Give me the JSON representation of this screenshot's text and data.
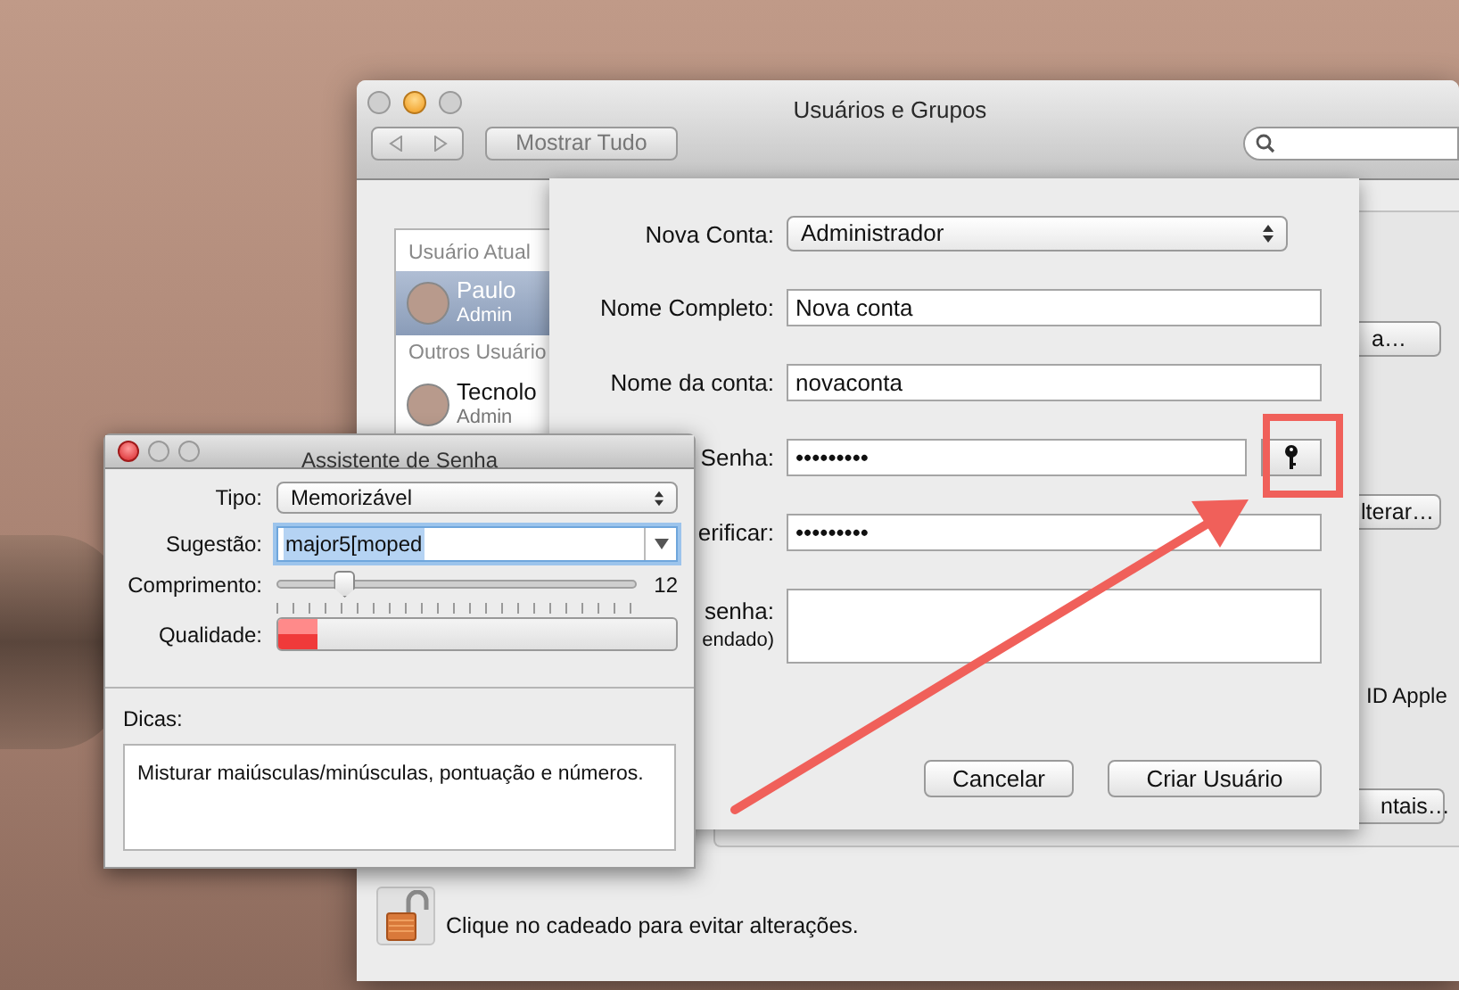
{
  "main_window": {
    "title": "Usuários e Grupos",
    "show_all_button": "Mostrar Tudo",
    "sidebar": {
      "sections": [
        {
          "header": "Usuário Atual",
          "users": [
            {
              "name": "Paulo",
              "role": "Admin",
              "selected": true
            }
          ]
        },
        {
          "header": "Outros Usuário",
          "users": [
            {
              "name": "Tecnolo",
              "role": "Admin",
              "selected": false
            }
          ]
        }
      ]
    },
    "account_pane": {
      "change_password_button": "a…",
      "change_button": "lterar…",
      "option_text": "ID Apple",
      "parental_controls_button": "ntais…"
    },
    "lock_message": "Clique no cadeado para evitar alterações."
  },
  "new_account_sheet": {
    "fields": [
      {
        "kind": "popup",
        "label": "Nova Conta:",
        "value": "Administrador"
      },
      {
        "kind": "text",
        "label": "Nome Completo:",
        "value": "Nova conta"
      },
      {
        "kind": "text",
        "label": "Nome da conta:",
        "value": "novaconta"
      },
      {
        "kind": "password",
        "label": "Senha:",
        "value": "•••••••••"
      },
      {
        "kind": "text",
        "label": "erificar:",
        "value": "•••••••••"
      },
      {
        "kind": "textarea",
        "label": "senha:",
        "sublabel": "endado)"
      }
    ],
    "buttons": [
      "Cancelar",
      "Criar Usuário"
    ]
  },
  "password_assistant": {
    "title": "Assistente de Senha",
    "type": {
      "label": "Tipo:",
      "value": "Memorizável"
    },
    "suggestion": {
      "label": "Sugestão:",
      "value": "major5[moped"
    },
    "length": {
      "label": "Comprimento:",
      "level": 0.19,
      "reading": "12"
    },
    "quality": {
      "label": "Qualidade:",
      "level": 0.1
    },
    "tips": {
      "label": "Dicas:",
      "text": "Misturar maiúsculas/minúsculas, pontuação e números."
    }
  }
}
